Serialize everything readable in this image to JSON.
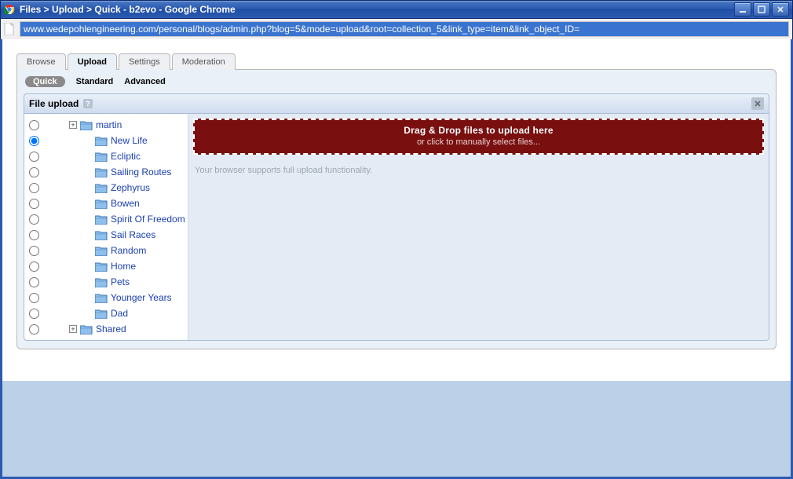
{
  "window": {
    "title": "Files > Upload > Quick - b2evo - Google Chrome"
  },
  "address": {
    "url": "www.wedepohlengineering.com/personal/blogs/admin.php?blog=5&mode=upload&root=collection_5&link_type=item&link_object_ID="
  },
  "tabs": {
    "items": [
      "Browse",
      "Upload",
      "Settings",
      "Moderation"
    ],
    "active_index": 1
  },
  "subtabs": {
    "items": [
      "Quick",
      "Standard",
      "Advanced"
    ],
    "active_index": 0
  },
  "panel": {
    "title": "File upload"
  },
  "tree": {
    "selected_index": 1,
    "items": [
      {
        "label": "martin",
        "expandable": true
      },
      {
        "label": "New Life"
      },
      {
        "label": "Ecliptic"
      },
      {
        "label": "Sailing Routes"
      },
      {
        "label": "Zephyrus"
      },
      {
        "label": "Bowen"
      },
      {
        "label": "Spirit Of Freedom"
      },
      {
        "label": "Sail Races"
      },
      {
        "label": "Random"
      },
      {
        "label": "Home"
      },
      {
        "label": "Pets"
      },
      {
        "label": "Younger Years"
      },
      {
        "label": "Dad"
      },
      {
        "label": "Shared",
        "expandable": true
      }
    ]
  },
  "dropzone": {
    "title": "Drag & Drop files to upload here",
    "subtitle": "or click to manually select files..."
  },
  "support_note": "Your browser supports full upload functionality."
}
